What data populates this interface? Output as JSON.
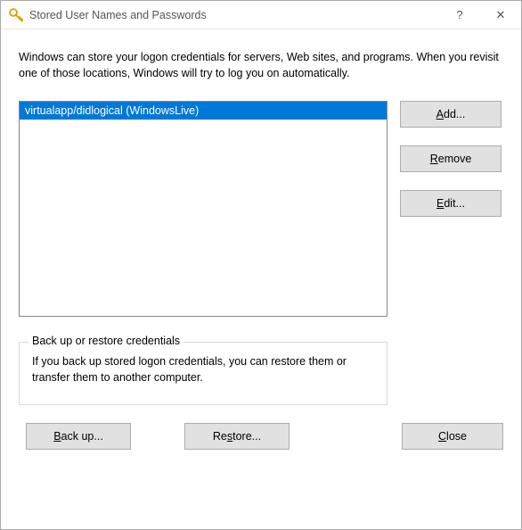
{
  "window": {
    "title": "Stored User Names and Passwords",
    "help_glyph": "?",
    "close_glyph": "✕"
  },
  "intro": "Windows can store your logon credentials for servers, Web sites, and programs. When you revisit one of those locations, Windows will try to log you on automatically.",
  "credentials": [
    {
      "label": "virtualapp/didlogical (WindowsLive)",
      "selected": true
    }
  ],
  "buttons": {
    "add_prefix": "A",
    "add_rest": "dd...",
    "remove_prefix": "R",
    "remove_rest": "emove",
    "edit_prefix": "E",
    "edit_rest": "dit...",
    "backup_prefix": "B",
    "backup_rest": "ack up...",
    "restore_prefix": "",
    "restore_label": "Restore...",
    "restore_ul": "s",
    "close_prefix": "C",
    "close_rest": "lose"
  },
  "group": {
    "title": "Back up or restore credentials",
    "text": "If you back up stored logon credentials, you can restore them or transfer them to another computer."
  }
}
